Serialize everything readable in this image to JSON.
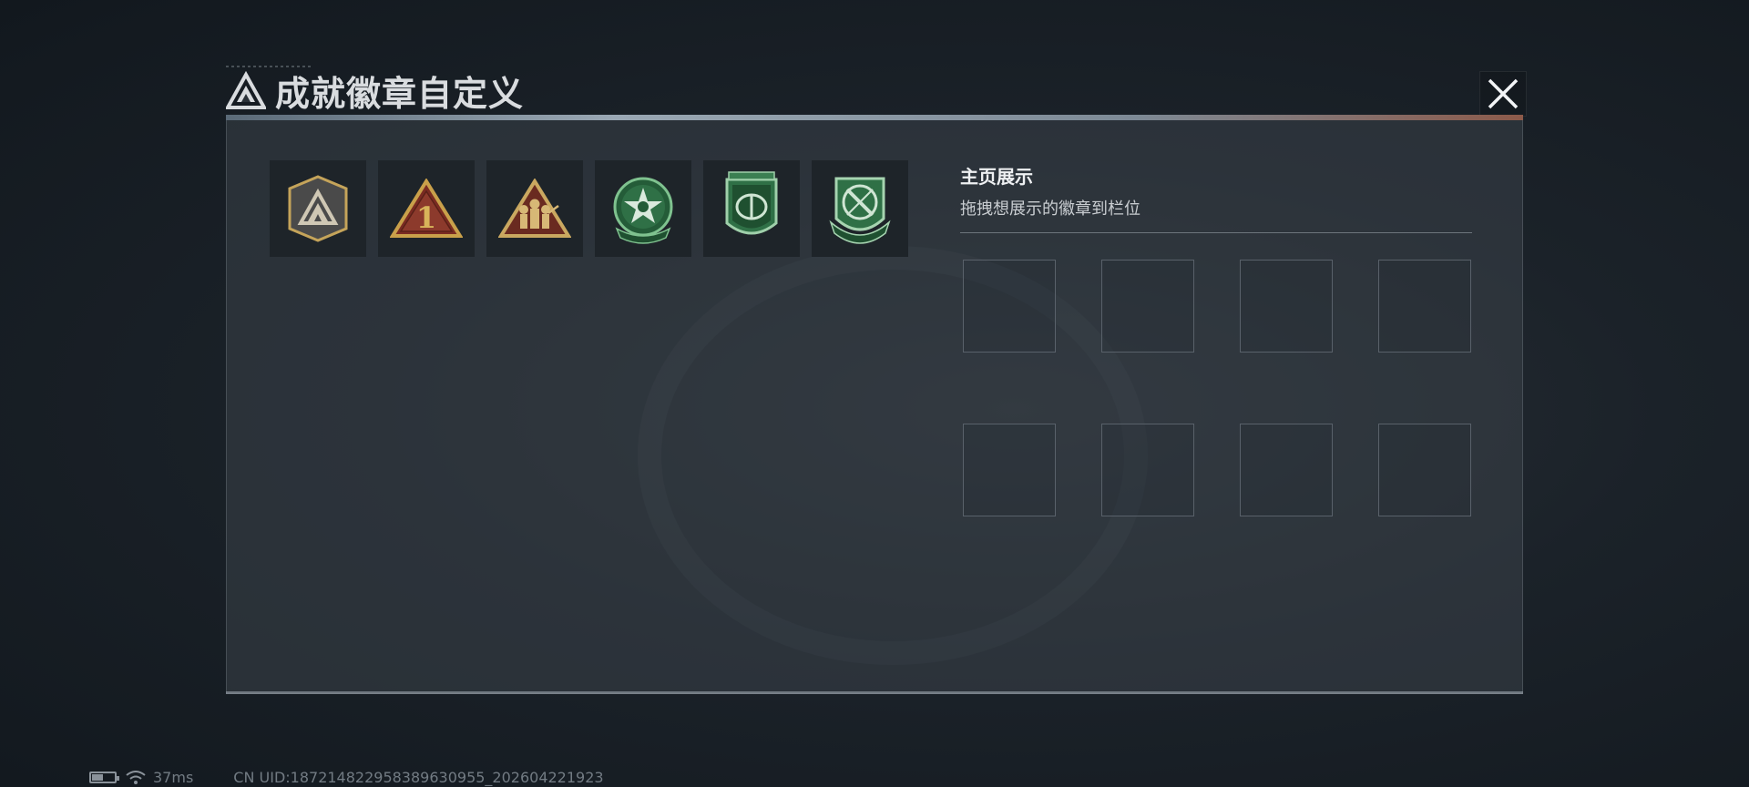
{
  "dialog": {
    "title": "成就徽章自定义",
    "close_icon": "close-icon"
  },
  "badges": [
    {
      "name": "shield-peak-badge",
      "accent": "#c5a45a"
    },
    {
      "name": "rank-one-triangle-badge",
      "accent": "#c9a04a"
    },
    {
      "name": "squad-triangle-badge",
      "accent": "#caa860"
    },
    {
      "name": "star-circle-badge",
      "accent": "#3f8f5a"
    },
    {
      "name": "eye-shield-badge",
      "accent": "#3f8f5a"
    },
    {
      "name": "crossed-knife-badge",
      "accent": "#3f8f5a"
    }
  ],
  "showcase": {
    "title": "主页展示",
    "subtitle": "拖拽想展示的徽章到栏位",
    "slot_count": 8
  },
  "status": {
    "ping": "37ms",
    "uid": "CN UID:187214822958389630955_202604221923"
  }
}
